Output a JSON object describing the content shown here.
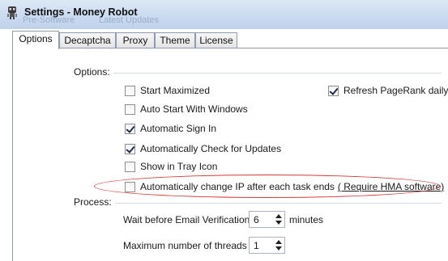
{
  "window": {
    "title": "Settings - Money Robot",
    "ghost_left": "Pre-Software",
    "ghost_right": "Latest Updates"
  },
  "tabs": [
    {
      "label": "Options",
      "active": true
    },
    {
      "label": "Decaptcha",
      "active": false
    },
    {
      "label": "Proxy",
      "active": false
    },
    {
      "label": "Theme",
      "active": false
    },
    {
      "label": "License",
      "active": false
    }
  ],
  "options_group": {
    "label": "Options:",
    "items": [
      {
        "label": "Start Maximized",
        "checked": false
      },
      {
        "label": "Auto Start With Windows",
        "checked": false
      },
      {
        "label": "Automatic Sign In",
        "checked": true
      },
      {
        "label": "Automatically Check for Updates",
        "checked": true
      },
      {
        "label": "Show in Tray Icon",
        "checked": false
      },
      {
        "label": "Automatically change IP after each task ends",
        "link": "( Require HMA software)",
        "checked": false
      }
    ],
    "right_items": [
      {
        "label": "Refresh PageRank daily",
        "checked": true
      }
    ]
  },
  "process_group": {
    "label": "Process:",
    "email_wait": {
      "label": "Wait before Email Verification:",
      "value": "6",
      "unit": "minutes"
    },
    "max_threads": {
      "label": "Maximum number of threads",
      "value": "1"
    }
  }
}
